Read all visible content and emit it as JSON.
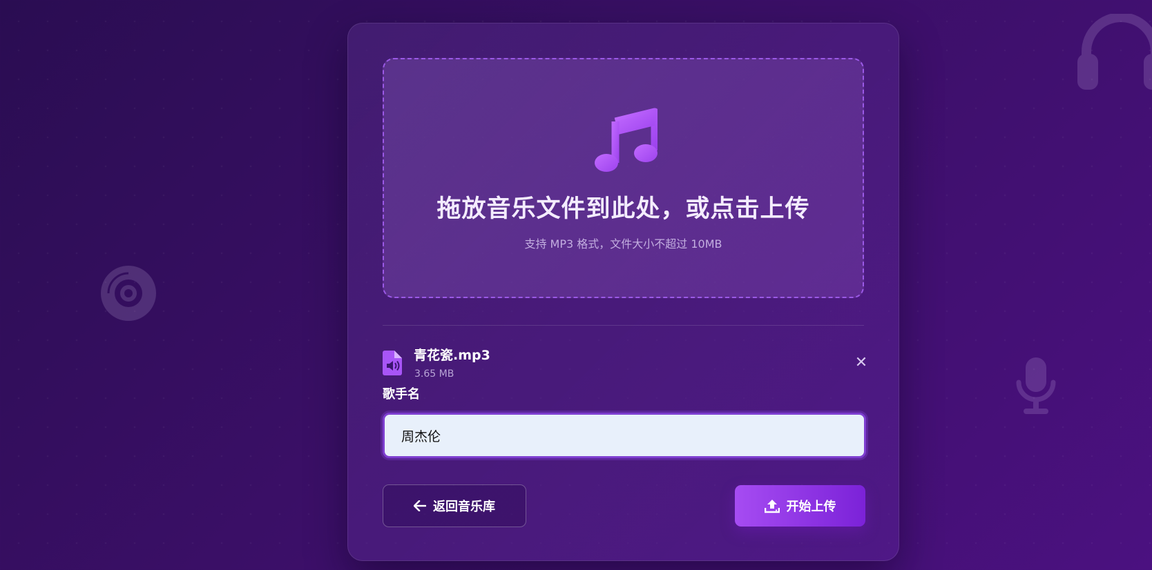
{
  "colors": {
    "background": "#3a0f66",
    "accent": "#a855f7",
    "accent_dark": "#7b22d8",
    "input_bg": "#e8f0fb"
  },
  "background_icons": [
    "headphones-icon",
    "disc-icon",
    "microphone-icon"
  ],
  "dropzone": {
    "icon": "music-note-icon",
    "title": "拖放音乐文件到此处，或点击上传",
    "hint": "支持 MP3 格式，文件大小不超过 10MB"
  },
  "file": {
    "icon": "audio-file-icon",
    "name": "青花瓷.mp3",
    "size": "3.65 MB",
    "remove_icon": "close-icon",
    "remove_symbol": "✕"
  },
  "singer": {
    "label": "歌手名",
    "value": "周杰伦"
  },
  "actions": {
    "back_label": "返回音乐库",
    "back_icon": "arrow-left-icon",
    "upload_label": "开始上传",
    "upload_icon": "upload-icon"
  }
}
